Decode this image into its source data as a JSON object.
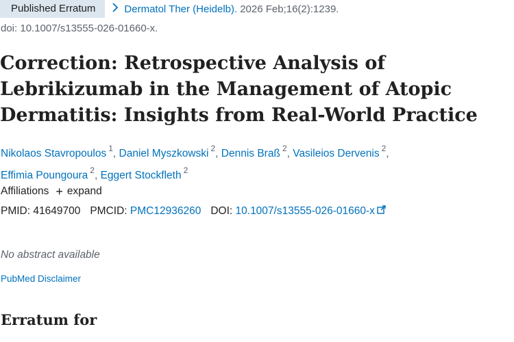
{
  "header": {
    "badge": "Published Erratum",
    "journal": "Dermatol Ther (Heidelb).",
    "citation": "2026 Feb;16(2):1239.",
    "doi_line": "doi: 10.1007/s13555-026-01660-x."
  },
  "title": "Correction: Retrospective Analysis of Lebrikizumab in the Management of Atopic Dermatitis: Insights from Real-World Practice",
  "authors": [
    {
      "name": "Nikolaos Stavropoulos",
      "aff": "1"
    },
    {
      "name": "Daniel Myszkowski",
      "aff": "2"
    },
    {
      "name": "Dennis Braß",
      "aff": "2"
    },
    {
      "name": "Vasileios Dervenis",
      "aff": "2"
    },
    {
      "name": "Effimia Poungoura",
      "aff": "2"
    },
    {
      "name": "Eggert Stockfleth",
      "aff": "2"
    }
  ],
  "affiliations": {
    "label": "Affiliations",
    "expand_label": "expand"
  },
  "ids": {
    "pmid_label": "PMID:",
    "pmid": "41649700",
    "pmcid_label": "PMCID:",
    "pmcid": "PMC12936260",
    "doi_label": "DOI:",
    "doi": "10.1007/s13555-026-01660-x"
  },
  "abstract_note": "No abstract available",
  "disclaimer": "PubMed Disclaimer",
  "section_heading": "Erratum for"
}
